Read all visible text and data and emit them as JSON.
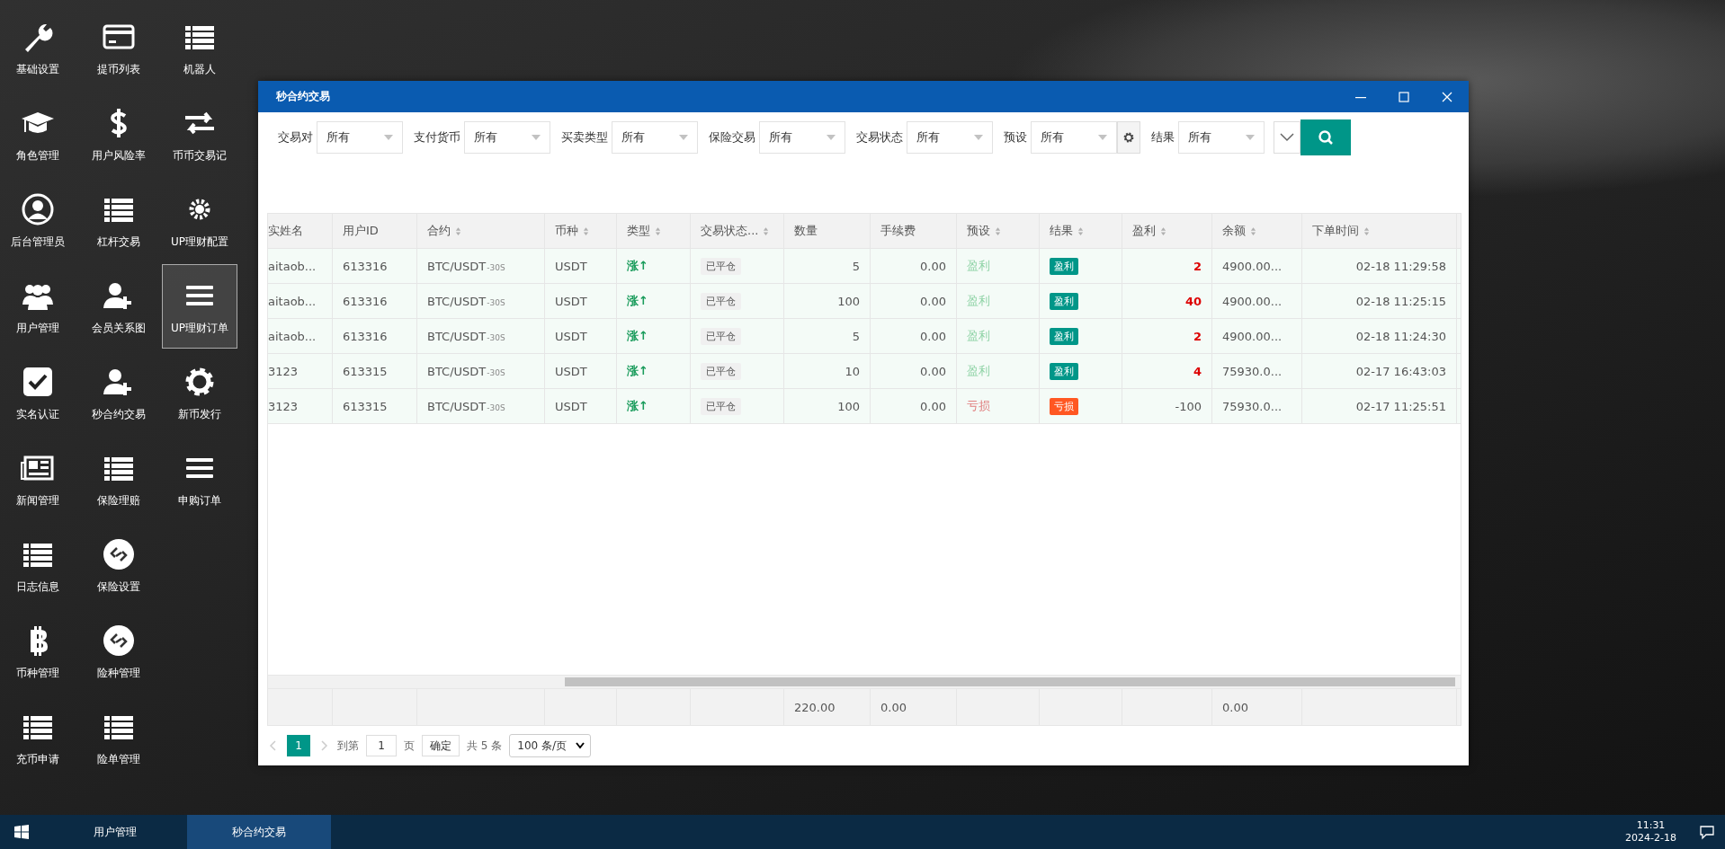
{
  "desktop_icons": [
    [
      {
        "label": "基础设置",
        "selected": false
      },
      {
        "label": "提币列表",
        "selected": false
      },
      {
        "label": "机器人",
        "selected": false
      }
    ],
    [
      {
        "label": "角色管理",
        "selected": false
      },
      {
        "label": "用户风险率",
        "selected": false
      },
      {
        "label": "币币交易记",
        "selected": false
      }
    ],
    [
      {
        "label": "后台管理员",
        "selected": false
      },
      {
        "label": "杠杆交易",
        "selected": false
      },
      {
        "label": "UP理财配置",
        "selected": false
      }
    ],
    [
      {
        "label": "用户管理",
        "selected": false
      },
      {
        "label": "会员关系图",
        "selected": false
      },
      {
        "label": "UP理财订单",
        "selected": true
      }
    ],
    [
      {
        "label": "实名认证",
        "selected": false
      },
      {
        "label": "秒合约交易",
        "selected": false
      },
      {
        "label": "新币发行",
        "selected": false
      }
    ],
    [
      {
        "label": "新闻管理",
        "selected": false
      },
      {
        "label": "保险理赔",
        "selected": false
      },
      {
        "label": "申购订单",
        "selected": false
      }
    ],
    [
      {
        "label": "日志信息",
        "selected": false
      },
      {
        "label": "保险设置",
        "selected": false
      }
    ],
    [
      {
        "label": "币种管理",
        "selected": false
      },
      {
        "label": "险种管理",
        "selected": false
      }
    ],
    [
      {
        "label": "充币申请",
        "selected": false
      },
      {
        "label": "险单管理",
        "selected": false
      }
    ]
  ],
  "window": {
    "title": "秒合约交易",
    "filters": [
      {
        "kind": "select",
        "label": "交易对",
        "value": "所有"
      },
      {
        "kind": "select",
        "label": "支付货币",
        "value": "所有"
      },
      {
        "kind": "select",
        "label": "买卖类型",
        "value": "所有"
      },
      {
        "kind": "select",
        "label": "保险交易",
        "value": "所有"
      },
      {
        "kind": "select",
        "label": "交易状态",
        "value": "所有"
      },
      {
        "kind": "select",
        "label": "预设",
        "value": "所有"
      },
      {
        "kind": "settings"
      },
      {
        "kind": "select",
        "label": "结果",
        "value": "所有"
      }
    ],
    "table": {
      "columns": [
        {
          "label": "实姓名",
          "sortable": false
        },
        {
          "label": "用户ID",
          "sortable": false
        },
        {
          "label": "合约",
          "sortable": true
        },
        {
          "label": "币种",
          "sortable": true
        },
        {
          "label": "类型",
          "sortable": true
        },
        {
          "label": "交易状态...",
          "sortable": true
        },
        {
          "label": "数量",
          "sortable": false
        },
        {
          "label": "手续费",
          "sortable": false
        },
        {
          "label": "预设",
          "sortable": true
        },
        {
          "label": "结果",
          "sortable": true
        },
        {
          "label": "盈利",
          "sortable": true
        },
        {
          "label": "余额",
          "sortable": true
        },
        {
          "label": "下单时间",
          "sortable": true
        }
      ],
      "rows": [
        {
          "name": "aitaob...",
          "user_id": "613316",
          "contract": "BTC/USDT",
          "contract_suffix": "-30S",
          "currency": "USDT",
          "type": "涨↑",
          "status": "已平仓",
          "quantity": "5",
          "fee": "0.00",
          "preset": {
            "text": "盈利",
            "kind": "profit"
          },
          "result": {
            "text": "盈利",
            "kind": "profit"
          },
          "profit": "2",
          "profit_highlight": true,
          "balance": "4900.00...",
          "time": "02-18 11:29:58"
        },
        {
          "name": "aitaob...",
          "user_id": "613316",
          "contract": "BTC/USDT",
          "contract_suffix": "-30S",
          "currency": "USDT",
          "type": "涨↑",
          "status": "已平仓",
          "quantity": "100",
          "fee": "0.00",
          "preset": {
            "text": "盈利",
            "kind": "profit"
          },
          "result": {
            "text": "盈利",
            "kind": "profit"
          },
          "profit": "40",
          "profit_highlight": true,
          "balance": "4900.00...",
          "time": "02-18 11:25:15"
        },
        {
          "name": "aitaob...",
          "user_id": "613316",
          "contract": "BTC/USDT",
          "contract_suffix": "-30S",
          "currency": "USDT",
          "type": "涨↑",
          "status": "已平仓",
          "quantity": "5",
          "fee": "0.00",
          "preset": {
            "text": "盈利",
            "kind": "profit"
          },
          "result": {
            "text": "盈利",
            "kind": "profit"
          },
          "profit": "2",
          "profit_highlight": true,
          "balance": "4900.00...",
          "time": "02-18 11:24:30"
        },
        {
          "name": "3123",
          "user_id": "613315",
          "contract": "BTC/USDT",
          "contract_suffix": "-30S",
          "currency": "USDT",
          "type": "涨↑",
          "status": "已平仓",
          "quantity": "10",
          "fee": "0.00",
          "preset": {
            "text": "盈利",
            "kind": "profit"
          },
          "result": {
            "text": "盈利",
            "kind": "profit"
          },
          "profit": "4",
          "profit_highlight": true,
          "balance": "75930.0...",
          "time": "02-17 16:43:03"
        },
        {
          "name": "3123",
          "user_id": "613315",
          "contract": "BTC/USDT",
          "contract_suffix": "-30S",
          "currency": "USDT",
          "type": "涨↑",
          "status": "已平仓",
          "quantity": "100",
          "fee": "0.00",
          "preset": {
            "text": "亏损",
            "kind": "loss"
          },
          "result": {
            "text": "亏损",
            "kind": "loss"
          },
          "profit": "-100",
          "profit_highlight": false,
          "balance": "75930.0...",
          "time": "02-17 11:25:51"
        }
      ],
      "totals": {
        "quantity": "220.00",
        "fee": "0.00",
        "balance": "0.00"
      }
    },
    "pager": {
      "pages": [
        {
          "label": "1",
          "selected": true
        }
      ],
      "goto_label": "到第",
      "goto_value": "1",
      "page_unit": "页",
      "confirm": "确定",
      "total": "共 5 条",
      "page_size": "100 条/页"
    }
  },
  "taskbar": {
    "items": [
      {
        "label": "用户管理",
        "selected": false
      },
      {
        "label": "秒合约交易",
        "selected": true
      }
    ],
    "time": "11:31",
    "date": "2024-2-18"
  }
}
